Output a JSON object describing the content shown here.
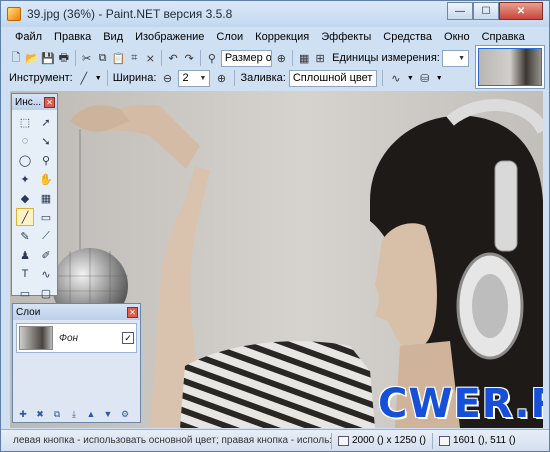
{
  "window": {
    "title": "39.jpg (36%) - Paint.NET версия 3.5.8",
    "minimize_glyph": "—",
    "maximize_glyph": "☐",
    "close_glyph": "✕"
  },
  "menu": [
    "Файл",
    "Правка",
    "Вид",
    "Изображение",
    "Слои",
    "Коррекция",
    "Эффекты",
    "Средства",
    "Окно",
    "Справка"
  ],
  "toolbar1": {
    "zoom_value": "Размер ок",
    "units_label": "Единицы измерения:"
  },
  "toolbar2": {
    "tool_label": "Инструмент:",
    "width_label": "Ширина:",
    "width_value": "2",
    "fill_label": "Заливка:",
    "fill_value": "Сплошной цвет"
  },
  "tools_panel": {
    "title": "Инс...",
    "close_glyph": "✕",
    "tools": [
      {
        "name": "rectangle-select-icon",
        "glyph": "⬚"
      },
      {
        "name": "move-selection-icon",
        "glyph": "➚"
      },
      {
        "name": "lasso-select-icon",
        "glyph": "◌"
      },
      {
        "name": "move-selected-icon",
        "glyph": "➘"
      },
      {
        "name": "ellipse-select-icon",
        "glyph": "◯"
      },
      {
        "name": "zoom-icon",
        "glyph": "⚲"
      },
      {
        "name": "magic-wand-icon",
        "glyph": "✦"
      },
      {
        "name": "pan-icon",
        "glyph": "✋"
      },
      {
        "name": "paint-bucket-icon",
        "glyph": "◆"
      },
      {
        "name": "gradient-icon",
        "glyph": "▦"
      },
      {
        "name": "paintbrush-icon",
        "glyph": "╱"
      },
      {
        "name": "eraser-icon",
        "glyph": "▭"
      },
      {
        "name": "pencil-icon",
        "glyph": "✎"
      },
      {
        "name": "color-picker-icon",
        "glyph": "⟋"
      },
      {
        "name": "clone-stamp-icon",
        "glyph": "♟"
      },
      {
        "name": "recolor-icon",
        "glyph": "✐"
      },
      {
        "name": "text-icon",
        "glyph": "T"
      },
      {
        "name": "line-curve-icon",
        "glyph": "∿"
      },
      {
        "name": "rectangle-icon",
        "glyph": "▭"
      },
      {
        "name": "rounded-rectangle-icon",
        "glyph": "▢"
      },
      {
        "name": "ellipse-icon",
        "glyph": "◯"
      },
      {
        "name": "freeform-shape-icon",
        "glyph": "◔"
      }
    ]
  },
  "layers_panel": {
    "title": "Слои",
    "close_glyph": "✕",
    "layer_name": "Фон",
    "layer_visible_glyph": "✓"
  },
  "watermark": "CWER.RU",
  "status": {
    "hint": "левая кнопка - использовать основной цвет; правая кнопка - использовать",
    "image_size": "2000 () x 1250 ()",
    "cursor_pos": "1601 (), 511 ()"
  },
  "colors": {
    "accent": "#1650d8",
    "title_bar": "#c2d7f0"
  }
}
